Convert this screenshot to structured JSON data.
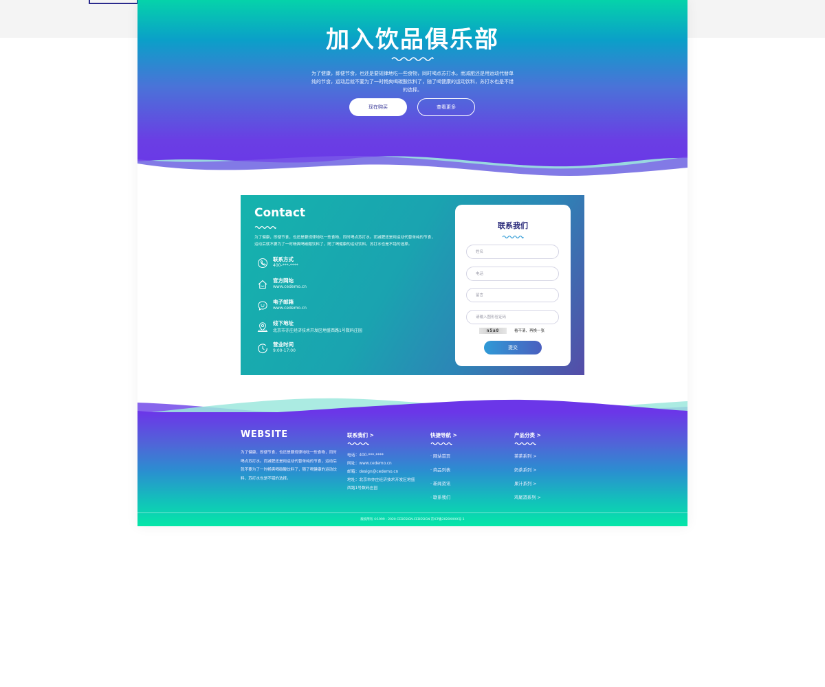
{
  "hero": {
    "title": "加入饮品俱乐部",
    "description": "为了健康，即便节食，也还是要规律地吃一些食物，同时喝点苏打水。而减肥还是用运动代替单纯的节食，运动后就不要为了一时畅爽喝碳酸饮料了，随了喝健康的运动饮料，苏打水也是不错的选择。",
    "buy_button": "现在购买",
    "more_button": "查看更多"
  },
  "contact": {
    "title": "Contact",
    "description": "为了健康，即便节食，也还是要规律地吃一些食物，同时喝点苏打水。而减肥还是用运动代替单纯的节食，运动后就不要为了一时畅爽喝碳酸饮料了，随了喝健康的运动饮料，苏打水也是不错的选择。",
    "items": [
      {
        "icon": "phone-icon",
        "title": "联系方式",
        "value": "400-***-****"
      },
      {
        "icon": "home-icon",
        "title": "官方网站",
        "value": "www.cedemo.cn"
      },
      {
        "icon": "chat-icon",
        "title": "电子邮箱",
        "value": "www.cedemo.cn"
      },
      {
        "icon": "location-icon",
        "title": "线下地址",
        "value": "北京市亦庄经济技术开发区地盛西路1号数码庄园"
      },
      {
        "icon": "clock-icon",
        "title": "营业时间",
        "value": "9:00-17:00"
      }
    ]
  },
  "form": {
    "title": "联系我们",
    "name_placeholder": "姓名",
    "phone_placeholder": "电话",
    "message_placeholder": "留言",
    "captcha_placeholder": "请输入图形验证码",
    "captcha_code": "n5a8",
    "captcha_refresh": "看不清、再换一张",
    "submit": "提交"
  },
  "footer": {
    "brand": "WEBSITE",
    "brand_desc": "为了健康，即便节食，也还是要规律地吃一些食物，同时喝点苏打水。而减肥还是用运动代替单纯的节食，运动后就不要为了一时畅爽喝碳酸饮料了，随了喝健康的运动饮料，苏打水也是不错的选择。",
    "contact_title": "联系我们  >",
    "contact_lines": [
      "电话：400-***-****",
      "网址：www.cedemo.cn",
      "邮箱：design@cedemo.cn",
      "地址：北京市亦庄经济技术开发区地盛",
      "西路1号数码庄园"
    ],
    "nav_title": "快捷导航  >",
    "nav_links": [
      "· 网站首页",
      "· 商品列表",
      "· 新闻资讯",
      "· 联系我们"
    ],
    "product_title": "产品分类  >",
    "product_links": [
      "茶茶系列 >",
      "奶茶系列 >",
      "果汁系列 >",
      "鸡尾酒系列 >"
    ],
    "copyright": "版权所有 ©1999 - 2020  CEDESIGN.CEDESIGN   京ICP备2020XXXX号-1"
  },
  "colors": {
    "hero_top": "#05d3aa",
    "hero_bottom": "#6b36e8",
    "footer_bottom": "#05e6a8",
    "form_title": "#2a2a7a"
  }
}
